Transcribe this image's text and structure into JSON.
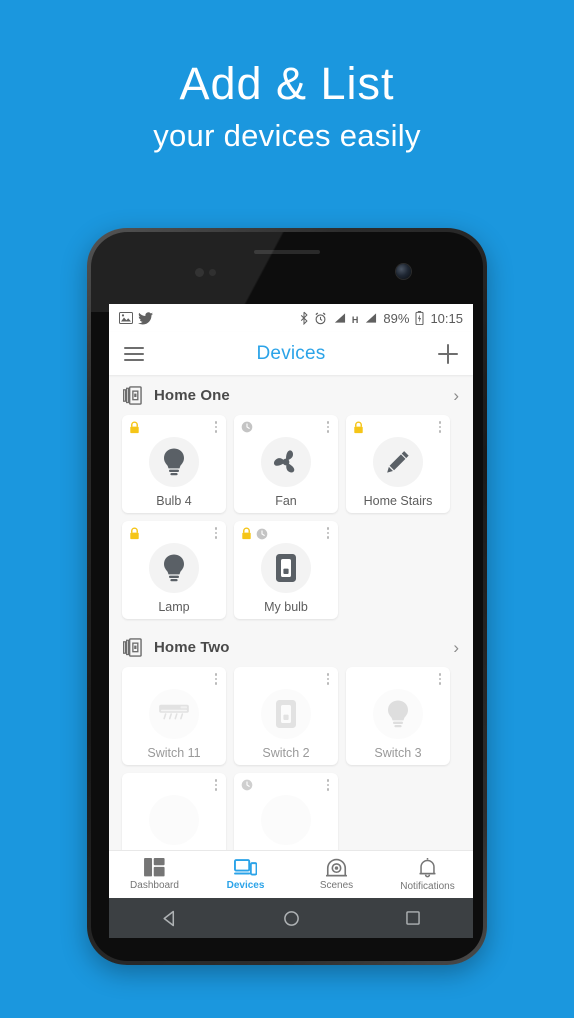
{
  "headline": {
    "line1": "Add & List",
    "line2": "your devices easily"
  },
  "theme": {
    "background": "#1b97de",
    "accent": "#2ba3e8",
    "lock_badge": "#f5c518",
    "icon_dark": "#5a6066",
    "icon_light": "#dcdcdc"
  },
  "statusbar": {
    "left_icons": [
      "image-icon",
      "twitter-icon"
    ],
    "right_icons": [
      "bluetooth-icon",
      "alarm-icon",
      "signal-icon",
      "signal-icon-2",
      "battery-icon"
    ],
    "network_type": "H",
    "battery": "89%",
    "time": "10:15"
  },
  "toolbar": {
    "menu_icon": "hamburger-icon",
    "title": "Devices",
    "add_icon": "plus-icon"
  },
  "sections": [
    {
      "title": "Home One",
      "icon": "home-group-icon",
      "chevron": "›",
      "dim": false,
      "devices": [
        {
          "label": "Bulb 4",
          "icon": "bulb-icon",
          "badges": [
            "lock"
          ]
        },
        {
          "label": "Fan",
          "icon": "fan-icon",
          "badges": [
            "clock"
          ]
        },
        {
          "label": "Home Stairs",
          "icon": "pencil-icon",
          "badges": [
            "lock"
          ]
        },
        {
          "label": "Lamp",
          "icon": "bulb-icon",
          "badges": [
            "lock"
          ]
        },
        {
          "label": "My bulb",
          "icon": "switch-icon",
          "badges": [
            "lock",
            "clock"
          ]
        }
      ]
    },
    {
      "title": "Home Two",
      "icon": "home-group-icon",
      "chevron": "›",
      "dim": true,
      "devices": [
        {
          "label": "Switch 11",
          "icon": "ac-icon",
          "badges": []
        },
        {
          "label": "Switch 2",
          "icon": "switch-icon",
          "badges": []
        },
        {
          "label": "Switch 3",
          "icon": "bulb-icon",
          "badges": []
        },
        {
          "label": "",
          "icon": "none",
          "badges": []
        },
        {
          "label": "",
          "icon": "none",
          "badges": [
            "clock"
          ]
        }
      ]
    }
  ],
  "bottomnav": {
    "items": [
      {
        "label": "Dashboard",
        "icon": "dashboard-icon",
        "active": false
      },
      {
        "label": "Devices",
        "icon": "devices-icon",
        "active": true
      },
      {
        "label": "Scenes",
        "icon": "scenes-icon",
        "active": false
      },
      {
        "label": "Notifications",
        "icon": "notifications-icon",
        "active": false
      }
    ]
  },
  "androidnav": {
    "back": "back-icon",
    "home": "home-icon",
    "recents": "recents-icon"
  }
}
